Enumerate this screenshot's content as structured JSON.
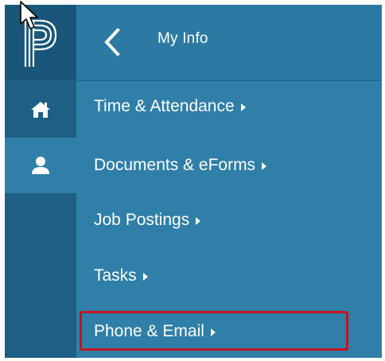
{
  "header": {
    "title": "My Info",
    "back_icon": "chevron-left-icon"
  },
  "rail": {
    "logo_icon": "app-logo",
    "items": [
      {
        "icon": "home-icon"
      },
      {
        "icon": "user-icon",
        "selected": true
      }
    ]
  },
  "menu": {
    "items": [
      {
        "label": "Time & Attendance"
      },
      {
        "label": "Documents & eForms"
      },
      {
        "label": "Job Postings"
      },
      {
        "label": "Tasks"
      },
      {
        "label": "Phone & Email",
        "highlighted": true
      }
    ]
  },
  "colors": {
    "panel": "#2f7fa8",
    "rail": "#1e5f86",
    "highlight": "#c4141e",
    "text": "#ffffff"
  }
}
